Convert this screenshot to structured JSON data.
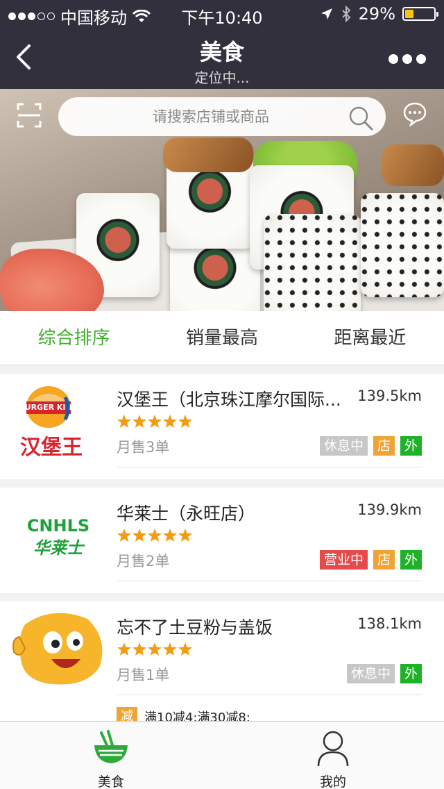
{
  "status_bar": {
    "carrier": "中国移动",
    "time": "下午10:40",
    "battery": "29%",
    "battery_level": 0.29
  },
  "nav": {
    "title": "美食",
    "subtitle": "定位中..."
  },
  "search": {
    "placeholder": "请搜索店铺或商品"
  },
  "sort_tabs": [
    {
      "label": "综合排序",
      "active": true
    },
    {
      "label": "销量最高",
      "active": false
    },
    {
      "label": "距离最近",
      "active": false
    }
  ],
  "shops": [
    {
      "name": "汉堡王（北京珠江摩尔国际...",
      "distance": "139.5km",
      "rating": 5,
      "sales": "月售3单",
      "logo_text_top": "BURGER KING",
      "logo_text_bottom": "汉堡王",
      "tags": [
        "休息中",
        "店",
        "外"
      ]
    },
    {
      "name": "华莱士（永旺店）",
      "distance": "139.9km",
      "rating": 5,
      "sales": "月售2单",
      "logo_text_top": "CNHLS",
      "logo_text_bottom": "华莱士",
      "tags": [
        "营业中",
        "店",
        "外"
      ]
    },
    {
      "name": "忘不了土豆粉与盖饭",
      "distance": "138.1km",
      "rating": 5,
      "sales": "月售1单",
      "tags": [
        "休息中",
        "外"
      ],
      "promo_badge": "减",
      "promo_text": "满10减4;满30减8;"
    }
  ],
  "bottom_tabs": [
    {
      "label": "美食",
      "icon": "bowl-icon",
      "active": true
    },
    {
      "label": "我的",
      "icon": "user-icon",
      "active": false
    }
  ],
  "colors": {
    "header_bg": "#33303e",
    "accent_green": "#3fae2a",
    "tag_closed": "#c7c7c7",
    "tag_open": "#e54b4b",
    "tag_store": "#f0a336",
    "tag_takeout": "#1fb128",
    "star": "#f39c12"
  }
}
